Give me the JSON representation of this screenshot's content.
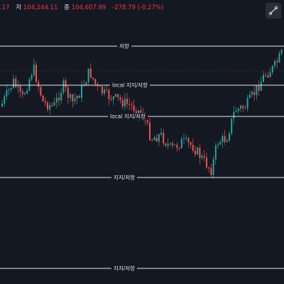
{
  "header": {
    "open_tail": ".17",
    "low_label": "저",
    "low_value": "104,244.11",
    "close_label": "종",
    "close_value": "104,607.99",
    "change": "-278.79 (-0.27%)"
  },
  "toolbar": {
    "drawing_tool_icon": "trend-line-icon"
  },
  "levels": {
    "resistance": "저항",
    "local_upper": "local 지지/저항",
    "local_lower": "local 지지/저항",
    "support_1": "지지/저항",
    "support_2": "지지/저항"
  },
  "colors": {
    "background": "#141823",
    "up": "#26a69a",
    "down": "#ef5350",
    "level_line": "#e6e8ee",
    "price_line": "#f23645"
  }
}
